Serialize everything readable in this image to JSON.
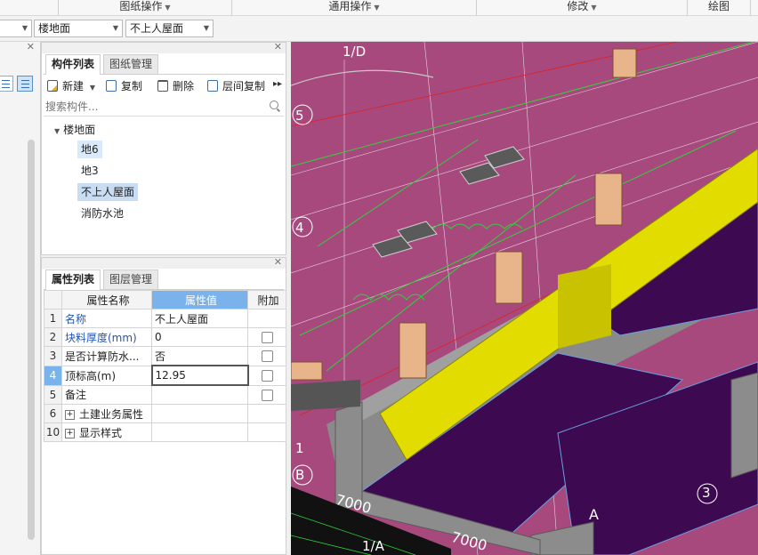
{
  "ribbon": {
    "groups": [
      {
        "label": "图纸操作"
      },
      {
        "label": "通用操作"
      },
      {
        "label": "修改"
      },
      {
        "label": "绘图"
      }
    ]
  },
  "selectors": {
    "floor_type": "楼地面",
    "component": "不上人屋面"
  },
  "component_panel": {
    "tabs": [
      "构件列表",
      "图纸管理"
    ],
    "toolbar": {
      "new": "新建",
      "copy": "复制",
      "delete": "删除",
      "floor_copy": "层间复制"
    },
    "search_placeholder": "搜索构件...",
    "tree": {
      "root": "楼地面",
      "items": [
        "地6",
        "地3",
        "不上人屋面",
        "消防水池"
      ]
    }
  },
  "property_panel": {
    "tabs": [
      "属性列表",
      "图层管理"
    ],
    "columns": [
      "属性名称",
      "属性值",
      "附加"
    ],
    "rows": [
      {
        "num": "1",
        "name": "名称",
        "value": "不上人屋面"
      },
      {
        "num": "2",
        "name": "块料厚度(mm)",
        "value": "0"
      },
      {
        "num": "3",
        "name": "是否计算防水...",
        "value": "否"
      },
      {
        "num": "4",
        "name": "顶标高(m)",
        "value": "12.95"
      },
      {
        "num": "5",
        "name": "备注",
        "value": ""
      },
      {
        "num": "6",
        "name": "土建业务属性",
        "value": ""
      },
      {
        "num": "10",
        "name": "显示样式",
        "value": ""
      }
    ]
  },
  "view3d": {
    "labels": [
      "1/D",
      "5",
      "4",
      "1",
      "B",
      "7000",
      "7000",
      "1/A",
      "3",
      "A"
    ],
    "colors": {
      "background": "#a8497e",
      "beam_yellow": "#e3dc00",
      "slab_purple": "#3d0a52",
      "beam_gray": "#8c8c8c",
      "column_tan": "#e8b58a",
      "cad_green": "#2fd13a",
      "cad_white": "#ffffff"
    }
  }
}
